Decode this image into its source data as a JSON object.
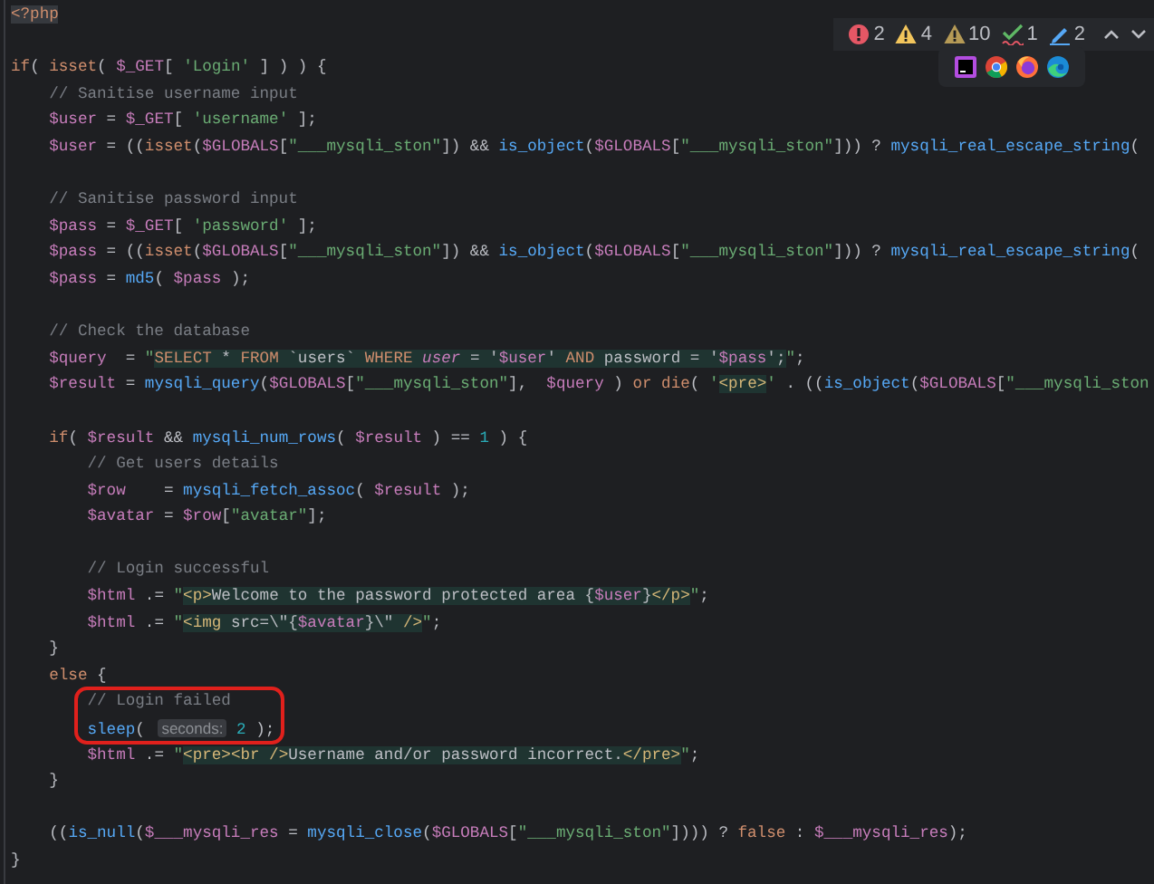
{
  "inspections": [
    {
      "kind": "error",
      "count": "2"
    },
    {
      "kind": "warning",
      "count": "4"
    },
    {
      "kind": "weak-warning",
      "count": "10"
    },
    {
      "kind": "typo",
      "count": "1"
    },
    {
      "kind": "edit",
      "count": "2"
    }
  ],
  "code_lines": [
    {
      "kind": "code",
      "tokens": [
        {
          "kind": "php-tag",
          "text": "<?php"
        }
      ]
    },
    {
      "kind": "blank"
    },
    {
      "kind": "code",
      "tokens": [
        {
          "kind": "keyword",
          "text": "if"
        },
        {
          "kind": "plain",
          "text": "( "
        },
        {
          "kind": "keyword",
          "text": "isset"
        },
        {
          "kind": "plain",
          "text": "( "
        },
        {
          "kind": "variable",
          "text": "$_GET"
        },
        {
          "kind": "plain",
          "text": "[ "
        },
        {
          "kind": "string",
          "text": "'Login'"
        },
        {
          "kind": "plain",
          "text": " ] ) ) {"
        }
      ]
    },
    {
      "kind": "code",
      "tokens": [
        {
          "kind": "comment",
          "text": "    // Sanitise username input"
        }
      ]
    },
    {
      "kind": "code",
      "tokens": [
        {
          "kind": "variable",
          "text": "    $user"
        },
        {
          "kind": "plain",
          "text": " = "
        },
        {
          "kind": "variable",
          "text": "$_GET"
        },
        {
          "kind": "plain",
          "text": "[ "
        },
        {
          "kind": "string",
          "text": "'username'"
        },
        {
          "kind": "plain",
          "text": " ];"
        }
      ]
    },
    {
      "kind": "code",
      "tokens": [
        {
          "kind": "variable",
          "text": "    $user"
        },
        {
          "kind": "plain",
          "text": " = (("
        },
        {
          "kind": "keyword",
          "text": "isset"
        },
        {
          "kind": "plain",
          "text": "("
        },
        {
          "kind": "variable",
          "text": "$GLOBALS"
        },
        {
          "kind": "plain",
          "text": "["
        },
        {
          "kind": "string",
          "text": "\"___mysqli_ston\""
        },
        {
          "kind": "plain",
          "text": "]) && "
        },
        {
          "kind": "function",
          "text": "is_object"
        },
        {
          "kind": "plain",
          "text": "("
        },
        {
          "kind": "variable",
          "text": "$GLOBALS"
        },
        {
          "kind": "plain",
          "text": "["
        },
        {
          "kind": "string",
          "text": "\"___mysqli_ston\""
        },
        {
          "kind": "plain",
          "text": "])) ? "
        },
        {
          "kind": "function",
          "text": "mysqli_real_escape_string"
        },
        {
          "kind": "plain",
          "text": "("
        }
      ]
    },
    {
      "kind": "blank"
    },
    {
      "kind": "code",
      "tokens": [
        {
          "kind": "comment",
          "text": "    // Sanitise password input"
        }
      ]
    },
    {
      "kind": "code",
      "tokens": [
        {
          "kind": "variable",
          "text": "    $pass"
        },
        {
          "kind": "plain",
          "text": " = "
        },
        {
          "kind": "variable",
          "text": "$_GET"
        },
        {
          "kind": "plain",
          "text": "[ "
        },
        {
          "kind": "string",
          "text": "'password'"
        },
        {
          "kind": "plain",
          "text": " ];"
        }
      ]
    },
    {
      "kind": "code",
      "tokens": [
        {
          "kind": "variable",
          "text": "    $pass"
        },
        {
          "kind": "plain",
          "text": " = (("
        },
        {
          "kind": "keyword",
          "text": "isset"
        },
        {
          "kind": "plain",
          "text": "("
        },
        {
          "kind": "variable",
          "text": "$GLOBALS"
        },
        {
          "kind": "plain",
          "text": "["
        },
        {
          "kind": "string",
          "text": "\"___mysqli_ston\""
        },
        {
          "kind": "plain",
          "text": "]) && "
        },
        {
          "kind": "function",
          "text": "is_object"
        },
        {
          "kind": "plain",
          "text": "("
        },
        {
          "kind": "variable",
          "text": "$GLOBALS"
        },
        {
          "kind": "plain",
          "text": "["
        },
        {
          "kind": "string",
          "text": "\"___mysqli_ston\""
        },
        {
          "kind": "plain",
          "text": "])) ? "
        },
        {
          "kind": "function",
          "text": "mysqli_real_escape_string"
        },
        {
          "kind": "plain",
          "text": "("
        }
      ]
    },
    {
      "kind": "code",
      "tokens": [
        {
          "kind": "variable",
          "text": "    $pass"
        },
        {
          "kind": "plain",
          "text": " = "
        },
        {
          "kind": "function",
          "text": "md5"
        },
        {
          "kind": "plain",
          "text": "( "
        },
        {
          "kind": "variable",
          "text": "$pass"
        },
        {
          "kind": "plain",
          "text": " );"
        }
      ]
    },
    {
      "kind": "blank"
    },
    {
      "kind": "code",
      "tokens": [
        {
          "kind": "comment",
          "text": "    // Check the database"
        }
      ]
    },
    {
      "kind": "code",
      "tokens": [
        {
          "kind": "variable",
          "text": "    $query"
        },
        {
          "kind": "plain",
          "text": "  = "
        },
        {
          "kind": "string",
          "text": "\""
        },
        {
          "kind": "sql-keyword",
          "text": "SELECT"
        },
        {
          "kind": "sql-text",
          "text": " * "
        },
        {
          "kind": "sql-keyword",
          "text": "FROM"
        },
        {
          "kind": "sql-text",
          "text": " `users` "
        },
        {
          "kind": "sql-keyword",
          "text": "WHERE"
        },
        {
          "kind": "sql-column",
          "text": " user"
        },
        {
          "kind": "sql-text",
          "text": " = '"
        },
        {
          "kind": "sql-variable",
          "text": "$user"
        },
        {
          "kind": "sql-text",
          "text": "' "
        },
        {
          "kind": "sql-keyword",
          "text": "AND"
        },
        {
          "kind": "sql-text",
          "text": " password = '"
        },
        {
          "kind": "sql-variable",
          "text": "$pass"
        },
        {
          "kind": "sql-text",
          "text": "';"
        },
        {
          "kind": "string",
          "text": "\""
        },
        {
          "kind": "plain",
          "text": ";"
        }
      ]
    },
    {
      "kind": "code",
      "tokens": [
        {
          "kind": "variable",
          "text": "    $result"
        },
        {
          "kind": "plain",
          "text": " = "
        },
        {
          "kind": "function",
          "text": "mysqli_query"
        },
        {
          "kind": "plain",
          "text": "("
        },
        {
          "kind": "variable",
          "text": "$GLOBALS"
        },
        {
          "kind": "plain",
          "text": "["
        },
        {
          "kind": "string",
          "text": "\"___mysqli_ston\""
        },
        {
          "kind": "plain",
          "text": "],  "
        },
        {
          "kind": "variable",
          "text": "$query"
        },
        {
          "kind": "plain",
          "text": " ) "
        },
        {
          "kind": "keyword",
          "text": "or "
        },
        {
          "kind": "keyword",
          "text": "die"
        },
        {
          "kind": "plain",
          "text": "( "
        },
        {
          "kind": "string",
          "text": "'"
        },
        {
          "kind": "html-tag",
          "text": "<pre>"
        },
        {
          "kind": "string",
          "text": "'"
        },
        {
          "kind": "plain",
          "text": " . (("
        },
        {
          "kind": "function",
          "text": "is_object"
        },
        {
          "kind": "plain",
          "text": "("
        },
        {
          "kind": "variable",
          "text": "$GLOBALS"
        },
        {
          "kind": "plain",
          "text": "["
        },
        {
          "kind": "string",
          "text": "\"___mysqli_ston"
        }
      ]
    },
    {
      "kind": "blank"
    },
    {
      "kind": "code",
      "tokens": [
        {
          "kind": "keyword",
          "text": "    if"
        },
        {
          "kind": "plain",
          "text": "( "
        },
        {
          "kind": "variable",
          "text": "$result"
        },
        {
          "kind": "plain",
          "text": " && "
        },
        {
          "kind": "function",
          "text": "mysqli_num_rows"
        },
        {
          "kind": "plain",
          "text": "( "
        },
        {
          "kind": "variable",
          "text": "$result"
        },
        {
          "kind": "plain",
          "text": " ) == "
        },
        {
          "kind": "number",
          "text": "1"
        },
        {
          "kind": "plain",
          "text": " ) {"
        }
      ]
    },
    {
      "kind": "code",
      "tokens": [
        {
          "kind": "comment",
          "text": "        // Get users details"
        }
      ]
    },
    {
      "kind": "code",
      "tokens": [
        {
          "kind": "variable",
          "text": "        $row"
        },
        {
          "kind": "plain",
          "text": "    = "
        },
        {
          "kind": "function",
          "text": "mysqli_fetch_assoc"
        },
        {
          "kind": "plain",
          "text": "( "
        },
        {
          "kind": "variable",
          "text": "$result"
        },
        {
          "kind": "plain",
          "text": " );"
        }
      ]
    },
    {
      "kind": "code",
      "tokens": [
        {
          "kind": "variable",
          "text": "        $avatar"
        },
        {
          "kind": "plain",
          "text": " = "
        },
        {
          "kind": "variable",
          "text": "$row"
        },
        {
          "kind": "plain",
          "text": "["
        },
        {
          "kind": "string",
          "text": "\"avatar\""
        },
        {
          "kind": "plain",
          "text": "];"
        }
      ]
    },
    {
      "kind": "blank"
    },
    {
      "kind": "code",
      "tokens": [
        {
          "kind": "comment",
          "text": "        // Login successful"
        }
      ]
    },
    {
      "kind": "code",
      "tokens": [
        {
          "kind": "variable",
          "text": "        $html"
        },
        {
          "kind": "plain",
          "text": " .= "
        },
        {
          "kind": "string",
          "text": "\""
        },
        {
          "kind": "html-tag",
          "text": "<p>"
        },
        {
          "kind": "html-text",
          "text": "Welcome to the password protected area {"
        },
        {
          "kind": "sql-variable",
          "text": "$user"
        },
        {
          "kind": "html-text",
          "text": "}"
        },
        {
          "kind": "html-tag",
          "text": "</p>"
        },
        {
          "kind": "string",
          "text": "\""
        },
        {
          "kind": "plain",
          "text": ";"
        }
      ]
    },
    {
      "kind": "code",
      "tokens": [
        {
          "kind": "variable",
          "text": "        $html"
        },
        {
          "kind": "plain",
          "text": " .= "
        },
        {
          "kind": "string",
          "text": "\""
        },
        {
          "kind": "html-tag",
          "text": "<img"
        },
        {
          "kind": "html-text",
          "text": " src=\\\"{"
        },
        {
          "kind": "sql-variable",
          "text": "$avatar"
        },
        {
          "kind": "html-text",
          "text": "}\\\" "
        },
        {
          "kind": "html-tag",
          "text": "/>"
        },
        {
          "kind": "string",
          "text": "\""
        },
        {
          "kind": "plain",
          "text": ";"
        }
      ]
    },
    {
      "kind": "code",
      "tokens": [
        {
          "kind": "plain",
          "text": "    }"
        }
      ]
    },
    {
      "kind": "code",
      "tokens": [
        {
          "kind": "keyword",
          "text": "    else"
        },
        {
          "kind": "plain",
          "text": " {"
        }
      ]
    },
    {
      "kind": "code",
      "tokens": [
        {
          "kind": "comment",
          "text": "        // Login failed"
        }
      ]
    },
    {
      "kind": "code",
      "tokens": [
        {
          "kind": "function",
          "text": "        sleep"
        },
        {
          "kind": "plain",
          "text": "( "
        },
        {
          "kind": "hint",
          "text": "seconds:"
        },
        {
          "kind": "number",
          "text": " 2"
        },
        {
          "kind": "plain",
          "text": " );"
        }
      ]
    },
    {
      "kind": "code",
      "tokens": [
        {
          "kind": "variable",
          "text": "        $html"
        },
        {
          "kind": "plain",
          "text": " .= "
        },
        {
          "kind": "string",
          "text": "\""
        },
        {
          "kind": "html-tag",
          "text": "<pre><br />"
        },
        {
          "kind": "html-text",
          "text": "Username and/or password incorrect."
        },
        {
          "kind": "html-tag",
          "text": "</pre>"
        },
        {
          "kind": "string",
          "text": "\""
        },
        {
          "kind": "plain",
          "text": ";"
        }
      ]
    },
    {
      "kind": "code",
      "tokens": [
        {
          "kind": "plain",
          "text": "    }"
        }
      ]
    },
    {
      "kind": "blank"
    },
    {
      "kind": "code",
      "tokens": [
        {
          "kind": "plain",
          "text": "    (("
        },
        {
          "kind": "function",
          "text": "is_null"
        },
        {
          "kind": "plain",
          "text": "("
        },
        {
          "kind": "variable",
          "text": "$___mysqli_res"
        },
        {
          "kind": "plain",
          "text": " = "
        },
        {
          "kind": "function",
          "text": "mysqli_close"
        },
        {
          "kind": "plain",
          "text": "("
        },
        {
          "kind": "variable",
          "text": "$GLOBALS"
        },
        {
          "kind": "plain",
          "text": "["
        },
        {
          "kind": "string",
          "text": "\"___mysqli_ston\""
        },
        {
          "kind": "plain",
          "text": "]))) ? "
        },
        {
          "kind": "keyword",
          "text": "false"
        },
        {
          "kind": "plain",
          "text": " : "
        },
        {
          "kind": "variable",
          "text": "$___mysqli_res"
        },
        {
          "kind": "plain",
          "text": ");"
        }
      ]
    },
    {
      "kind": "code",
      "tokens": [
        {
          "kind": "plain",
          "text": "}"
        }
      ]
    }
  ]
}
